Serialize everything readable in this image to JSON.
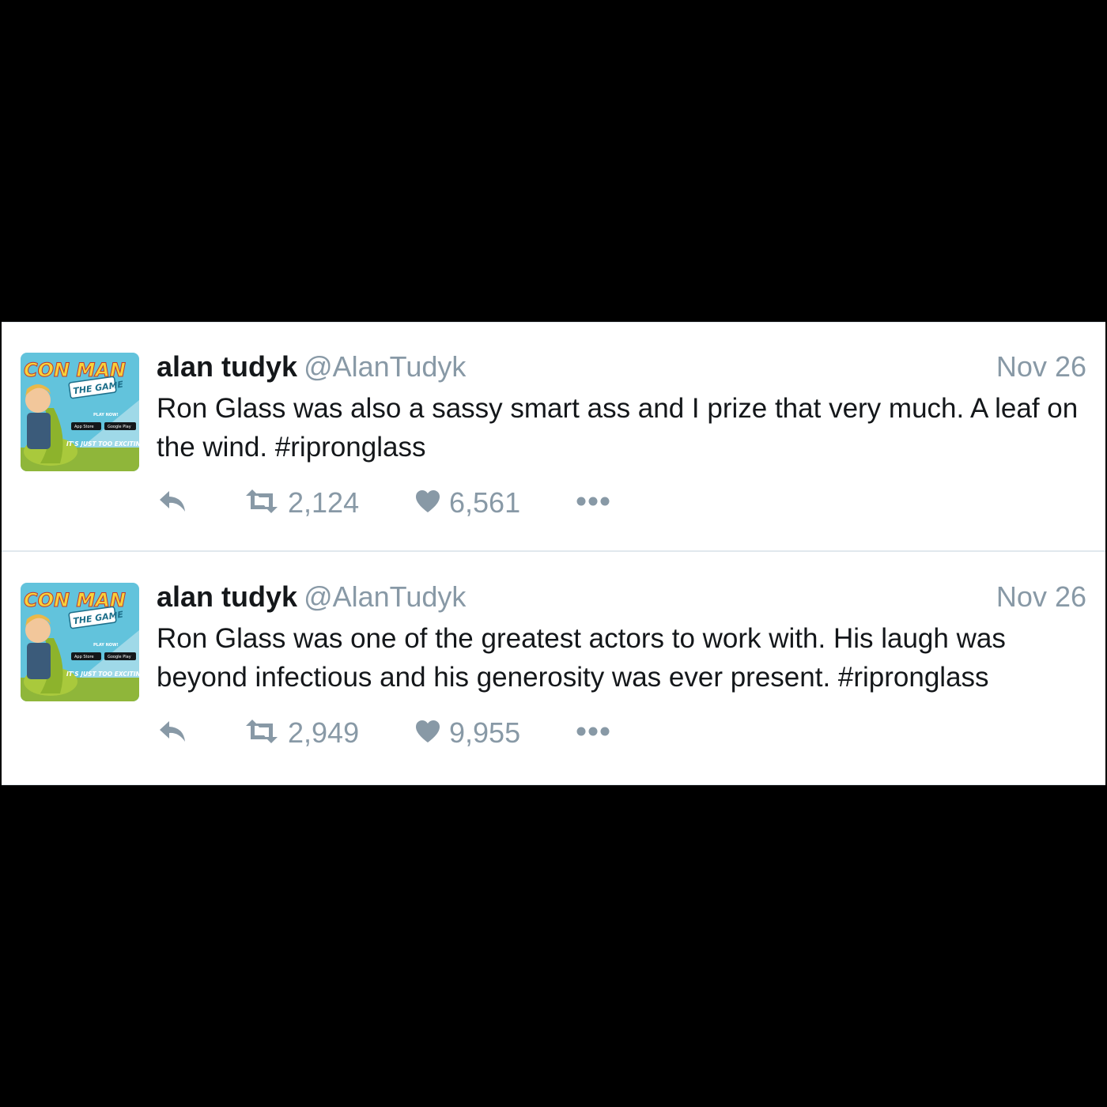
{
  "tweets": [
    {
      "name": "alan tudyk",
      "handle": "@AlanTudyk",
      "date": "Nov 26",
      "text": "Ron Glass was also a sassy smart ass and I prize that very much. A leaf on the wind. #ripronglass",
      "retweets": "2,124",
      "likes": "6,561",
      "avatar": {
        "title": "CON MAN",
        "subtitle": "THE GAME",
        "cta": "PLAY NOW!",
        "store1": "App Store",
        "store2": "Google Play",
        "tagline": "IT'S JUST TOO EXCITING"
      }
    },
    {
      "name": "alan tudyk",
      "handle": "@AlanTudyk",
      "date": "Nov 26",
      "text": "Ron Glass was one of the greatest actors to work with. His laugh was beyond infectious and his generosity was ever present. #ripronglass",
      "retweets": "2,949",
      "likes": "9,955",
      "avatar": {
        "title": "CON MAN",
        "subtitle": "THE GAME",
        "cta": "PLAY NOW!",
        "store1": "App Store",
        "store2": "Google Play",
        "tagline": "IT'S JUST TOO EXCITING"
      }
    }
  ],
  "icons": {
    "reply": "reply-icon",
    "retweet": "retweet-icon",
    "like": "heart-icon",
    "more": "more-icon"
  },
  "colors": {
    "text": "#14171a",
    "muted": "#8899a6",
    "icon": "#8899a6",
    "divider": "#e1e8ed"
  }
}
